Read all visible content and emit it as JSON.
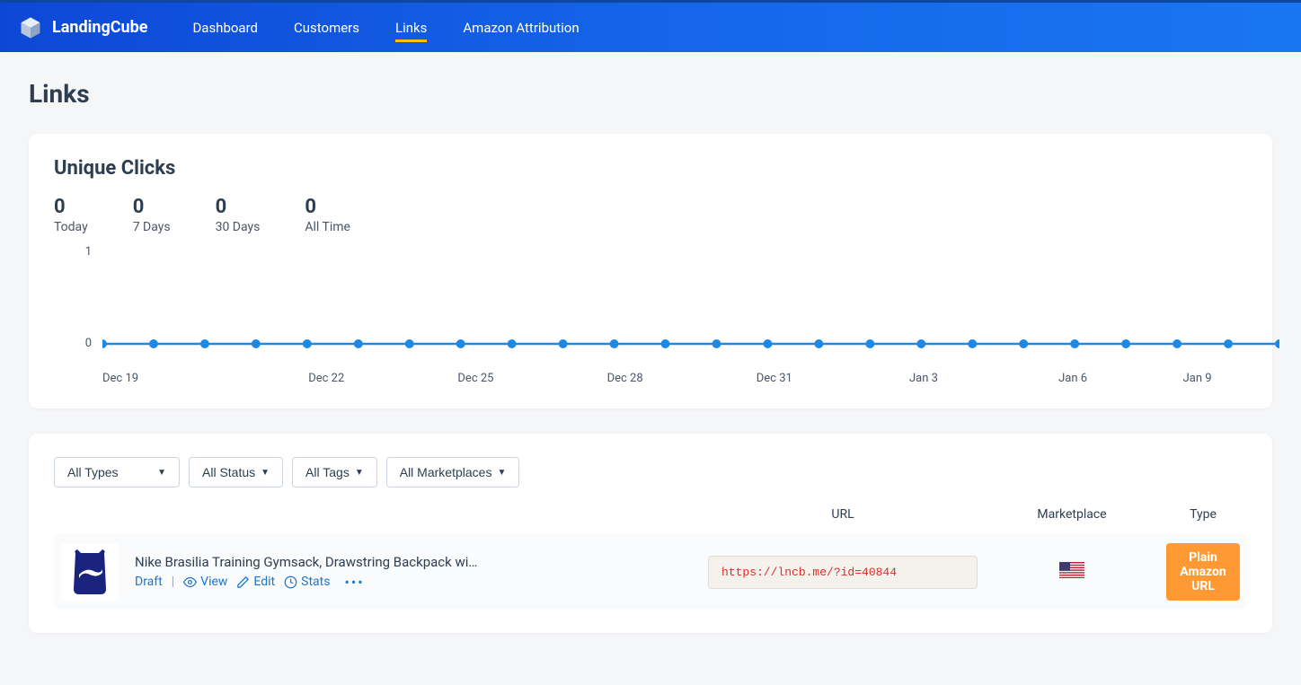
{
  "brand": {
    "name": "LandingCube"
  },
  "nav": {
    "items": [
      {
        "label": "Dashboard",
        "active": false
      },
      {
        "label": "Customers",
        "active": false
      },
      {
        "label": "Links",
        "active": true
      },
      {
        "label": "Amazon Attribution",
        "active": false
      }
    ]
  },
  "page": {
    "title": "Links"
  },
  "clicks_card": {
    "title": "Unique Clicks",
    "stats": [
      {
        "value": "0",
        "label": "Today"
      },
      {
        "value": "0",
        "label": "7 Days"
      },
      {
        "value": "0",
        "label": "30 Days"
      },
      {
        "value": "0",
        "label": "All Time"
      }
    ]
  },
  "chart_data": {
    "type": "line",
    "title": "Unique Clicks",
    "xlabel": "",
    "ylabel": "",
    "ylim": [
      0,
      1
    ],
    "y_ticks": [
      "1",
      "0"
    ],
    "categories": [
      "Dec 19",
      "Dec 20",
      "Dec 21",
      "Dec 22",
      "Dec 23",
      "Dec 24",
      "Dec 25",
      "Dec 26",
      "Dec 27",
      "Dec 28",
      "Dec 29",
      "Dec 30",
      "Dec 31",
      "Jan 1",
      "Jan 2",
      "Jan 3",
      "Jan 4",
      "Jan 5",
      "Jan 6",
      "Jan 7",
      "Jan 8",
      "Jan 9",
      "Jan 10",
      "Jan 11"
    ],
    "x_tick_labels": [
      "Dec 19",
      "Dec 22",
      "Dec 25",
      "Dec 28",
      "Dec 31",
      "Jan 3",
      "Jan 6",
      "Jan 9"
    ],
    "values": [
      0,
      0,
      0,
      0,
      0,
      0,
      0,
      0,
      0,
      0,
      0,
      0,
      0,
      0,
      0,
      0,
      0,
      0,
      0,
      0,
      0,
      0,
      0,
      0
    ]
  },
  "filters": {
    "types": "All Types",
    "status": "All Status",
    "tags": "All Tags",
    "marketplaces": "All Marketplaces"
  },
  "table": {
    "headers": {
      "url": "URL",
      "marketplace": "Marketplace",
      "type": "Type"
    },
    "rows": [
      {
        "name": "Nike Brasilia Training Gymsack, Drawstring Backpack wi…",
        "status": "Draft",
        "actions": {
          "view": "View",
          "edit": "Edit",
          "stats": "Stats"
        },
        "url": "https://lncb.me/?id=40844",
        "marketplace": "us",
        "type": "Plain Amazon URL"
      }
    ]
  }
}
